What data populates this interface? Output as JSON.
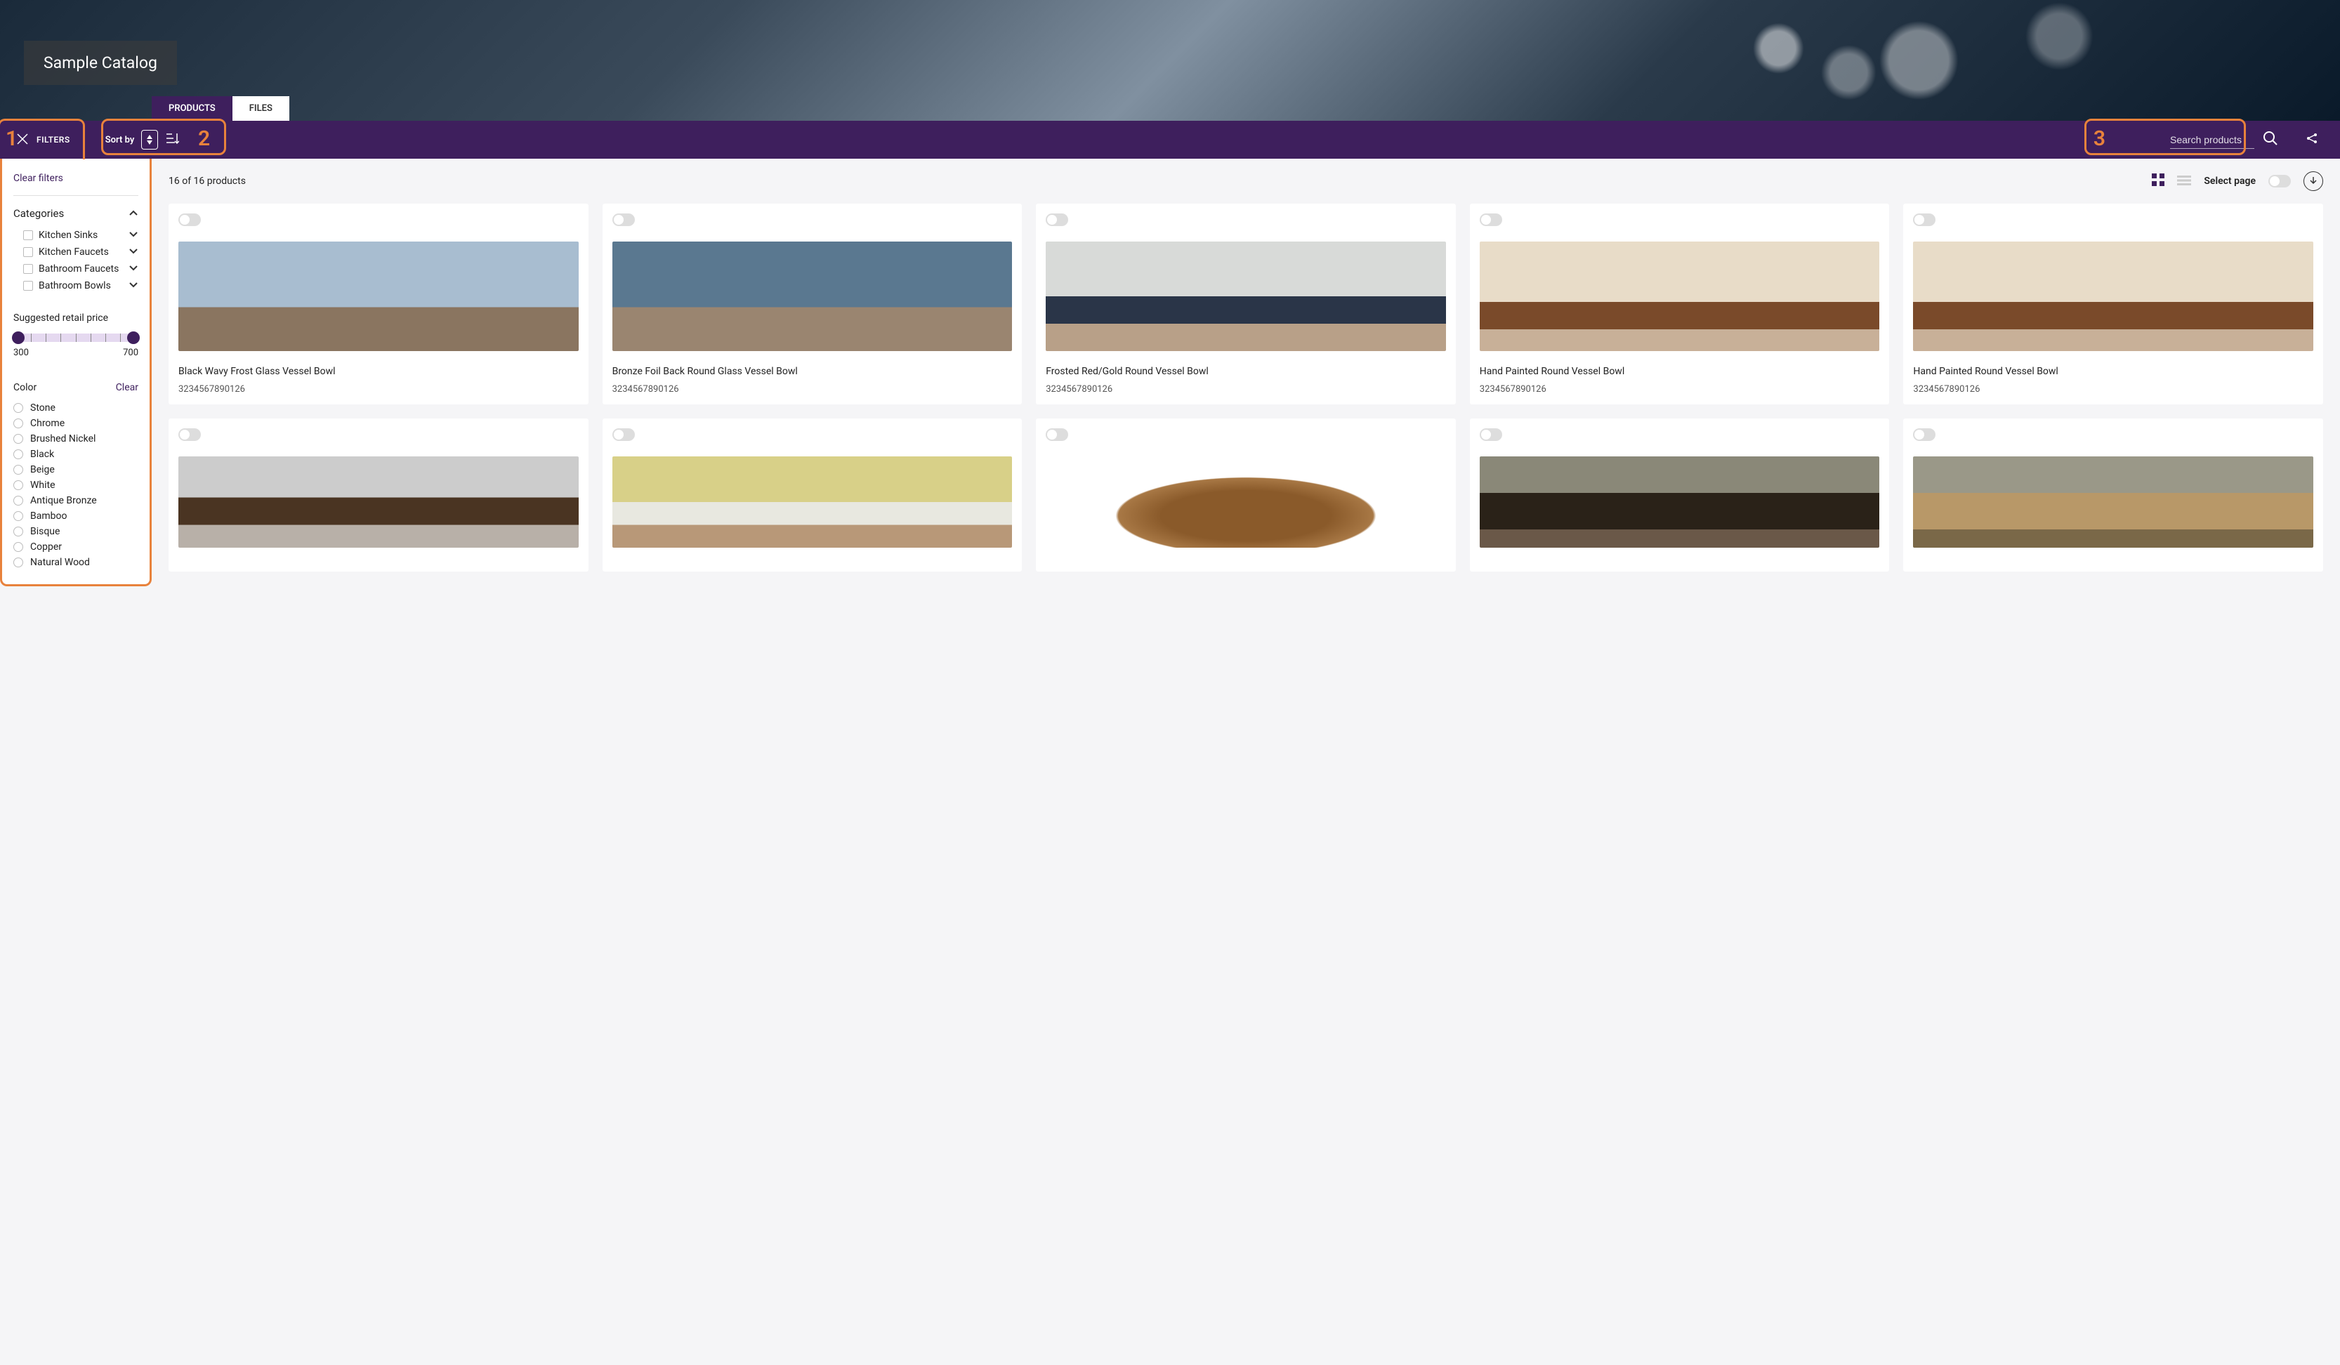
{
  "header": {
    "catalog_title": "Sample Catalog",
    "tabs": {
      "products": "PRODUCTS",
      "files": "FILES"
    }
  },
  "toolbar": {
    "filters_label": "FILTERS",
    "sort_label": "Sort by",
    "search_placeholder": "Search products"
  },
  "callouts": {
    "one": "1",
    "two": "2",
    "three": "3"
  },
  "sidebar": {
    "clear_filters": "Clear filters",
    "categories_label": "Categories",
    "categories": [
      {
        "label": "Kitchen Sinks"
      },
      {
        "label": "Kitchen Faucets"
      },
      {
        "label": "Bathroom Faucets"
      },
      {
        "label": "Bathroom Bowls"
      }
    ],
    "price_label": "Suggested retail price",
    "price_min": "300",
    "price_max": "700",
    "color_label": "Color",
    "color_clear": "Clear",
    "colors": [
      {
        "label": "Stone"
      },
      {
        "label": "Chrome"
      },
      {
        "label": "Brushed Nickel"
      },
      {
        "label": "Black"
      },
      {
        "label": "Beige"
      },
      {
        "label": "White"
      },
      {
        "label": "Antique Bronze"
      },
      {
        "label": "Bamboo"
      },
      {
        "label": "Bisque"
      },
      {
        "label": "Copper"
      },
      {
        "label": "Natural Wood"
      }
    ]
  },
  "main": {
    "count_text": "16 of 16 products",
    "select_page": "Select page"
  },
  "products": [
    {
      "title": "Black Wavy Frost Glass Vessel Bowl",
      "sku": "3234567890126",
      "scene": "scene-blue1"
    },
    {
      "title": "Bronze Foil Back Round Glass Vessel Bowl",
      "sku": "3234567890126",
      "scene": "scene-blue2"
    },
    {
      "title": "Frosted Red/Gold Round Vessel Bowl",
      "sku": "3234567890126",
      "scene": "scene-nav"
    },
    {
      "title": "Hand Painted Round Vessel Bowl",
      "sku": "3234567890126",
      "scene": "scene-wood"
    },
    {
      "title": "Hand Painted Round Vessel Bowl",
      "sku": "3234567890126",
      "scene": "scene-wood"
    },
    {
      "title": "",
      "sku": "",
      "scene": "scene-grey"
    },
    {
      "title": "",
      "sku": "",
      "scene": "scene-yel"
    },
    {
      "title": "",
      "sku": "",
      "scene": "scene-bowl"
    },
    {
      "title": "",
      "sku": "",
      "scene": "scene-dark"
    },
    {
      "title": "",
      "sku": "",
      "scene": "scene-tan"
    }
  ]
}
